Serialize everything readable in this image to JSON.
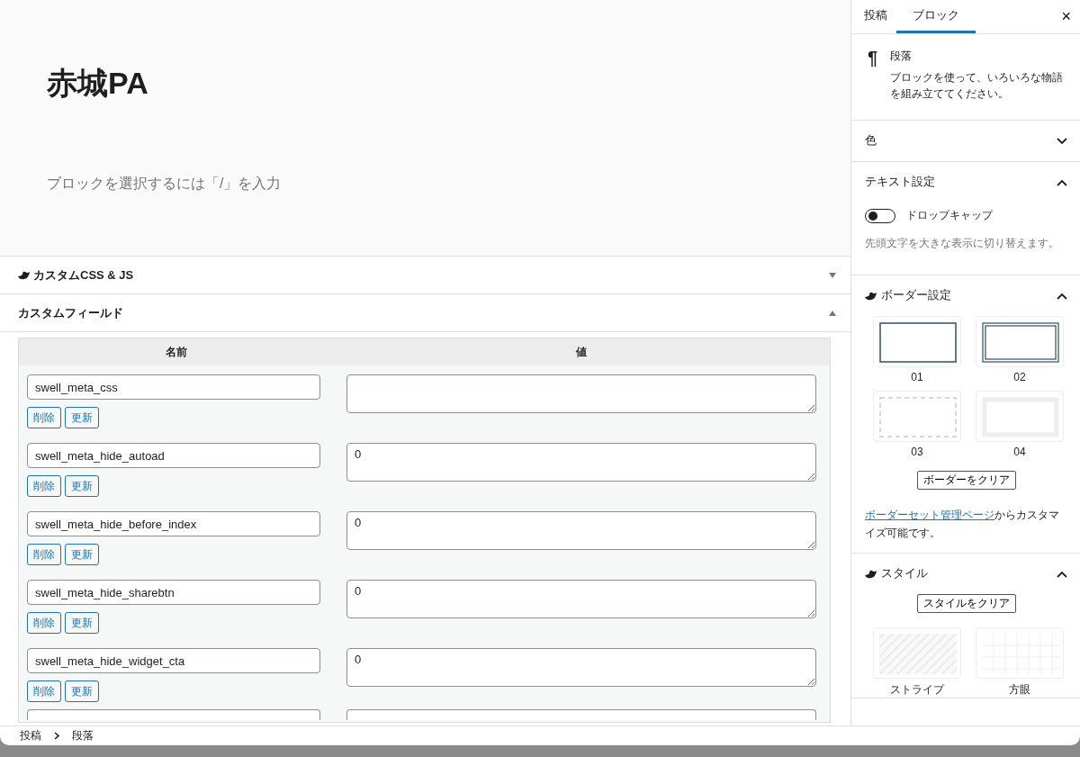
{
  "editor": {
    "title": "赤城PA",
    "placeholder": "ブロックを選択するには「/」を入力"
  },
  "panels": [
    {
      "kind": "css",
      "title": "カスタムCSS & JS",
      "expanded": false
    },
    {
      "kind": "fields",
      "title": "カスタムフィールド",
      "expanded": true
    }
  ],
  "custom_fields": {
    "columns": [
      "名前",
      "値"
    ],
    "more_rows_below": true,
    "rows": [
      {
        "name": "swell_meta_css",
        "value": "",
        "delete_label": "削除",
        "update_label": "更新"
      },
      {
        "name": "swell_meta_hide_autoad",
        "value": "0",
        "delete_label": "削除",
        "update_label": "更新"
      },
      {
        "name": "swell_meta_hide_before_index",
        "value": "0",
        "delete_label": "削除",
        "update_label": "更新"
      },
      {
        "name": "swell_meta_hide_sharebtn",
        "value": "0",
        "delete_label": "削除",
        "update_label": "更新"
      },
      {
        "name": "swell_meta_hide_widget_cta",
        "value": "0",
        "delete_label": "削除",
        "update_label": "更新"
      }
    ]
  },
  "sidebar": {
    "tabs": [
      {
        "label": "投稿",
        "selected": false
      },
      {
        "label": "ブロック",
        "selected": true
      }
    ],
    "close": "×",
    "block": {
      "icon": "¶",
      "name": "段落",
      "description": "ブロックを使って、いろいろな物語を組み立ててください。"
    },
    "sections": [
      {
        "kind": "color",
        "title": "色",
        "expanded": false
      },
      {
        "kind": "text",
        "title": "テキスト設定",
        "expanded": true,
        "toggle": {
          "label": "ドロップキャップ",
          "on": false
        },
        "help": "先頭文字を大きな表示に切り替えます。"
      },
      {
        "kind": "border",
        "title": "ボーダー設定",
        "expanded": true,
        "options": [
          {
            "label": "01"
          },
          {
            "label": "02"
          },
          {
            "label": "03"
          },
          {
            "label": "04"
          }
        ],
        "clear": "ボーダーをクリア",
        "link": "ボーダーセット管理ページ",
        "note": "からカスタマイズ可能です。"
      },
      {
        "kind": "style",
        "title": "スタイル",
        "expanded": true,
        "clear": "スタイルをクリア",
        "options": [
          {
            "label": "ストライプ"
          },
          {
            "label": "方眼"
          }
        ]
      }
    ]
  },
  "breadcrumb": [
    "投稿",
    "段落"
  ]
}
